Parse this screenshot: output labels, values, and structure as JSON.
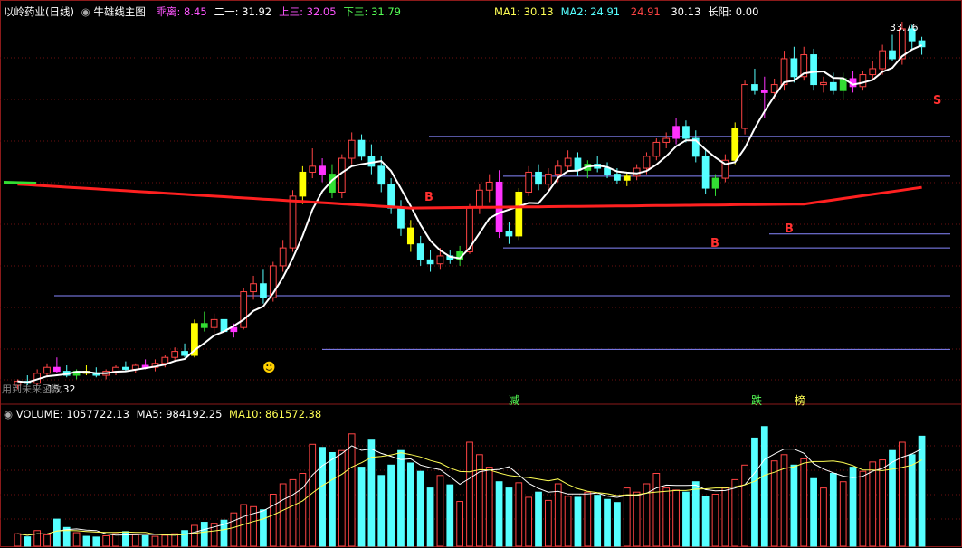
{
  "header": {
    "title": "以岭药业(日线)",
    "indicator_name": "牛雄线主图",
    "items": [
      {
        "label": "乖离:",
        "value": "8.45",
        "color": "#ff55ff"
      },
      {
        "label": "二一:",
        "value": "31.92",
        "color": "#ffffff"
      },
      {
        "label": "上三:",
        "value": "32.05",
        "color": "#ff55ff"
      },
      {
        "label": "下三:",
        "value": "31.79",
        "color": "#55ff55"
      }
    ],
    "ma": [
      {
        "label": "MA1:",
        "value": "30.13",
        "color": "#ffff55"
      },
      {
        "label": "MA2:",
        "value": "24.91",
        "color": "#55ffff"
      },
      {
        "label": "",
        "value": "24.91",
        "color": "#ff4444"
      },
      {
        "label": "",
        "value": "30.13",
        "color": "#ffffff"
      },
      {
        "label": "长阳:",
        "value": "0.00",
        "color": "#ffffff"
      }
    ]
  },
  "volume_header": {
    "volume": "VOLUME: 1057722.13",
    "ma5": "MA5: 984192.25",
    "ma10": "MA10: 861572.38",
    "colors": {
      "volume": "#ffffff",
      "ma5": "#ffffff",
      "ma10": "#ffff55"
    }
  },
  "labels": {
    "high_price": "33.76",
    "low_price": "15.32",
    "bottom_hint": "用到未来函数",
    "reduce": "减",
    "drop": "跌",
    "rank": "榜",
    "buy_marks": [
      "B",
      "B",
      "B",
      "B"
    ],
    "sell_mark": "S"
  },
  "colors": {
    "up": "#ff4444",
    "down": "#55ffff",
    "magenta": "#ff33ff",
    "yellow": "#ffff00",
    "green": "#33dd33",
    "white_line": "#ffffff",
    "red_line": "#ff2020",
    "guide": "#8888ff",
    "border": "#8b1a1a"
  },
  "chart_data": [
    {
      "type": "candlestick",
      "title": "以岭药业(日线)",
      "y_range": [
        15.32,
        33.76
      ],
      "ohlc": [
        [
          15.5,
          15.8,
          15.3,
          15.7
        ],
        [
          15.7,
          16.0,
          15.5,
          15.6
        ],
        [
          15.6,
          16.3,
          15.5,
          16.1
        ],
        [
          16.1,
          16.6,
          15.9,
          16.4
        ],
        [
          16.4,
          16.9,
          16.1,
          16.2
        ],
        [
          16.2,
          16.5,
          15.9,
          16.0
        ],
        [
          16.0,
          16.3,
          15.8,
          16.2
        ],
        [
          16.2,
          16.5,
          16.0,
          16.1
        ],
        [
          16.1,
          16.4,
          15.9,
          16.0
        ],
        [
          16.0,
          16.3,
          15.8,
          16.2
        ],
        [
          16.2,
          16.5,
          16.0,
          16.4
        ],
        [
          16.4,
          16.7,
          16.2,
          16.3
        ],
        [
          16.3,
          16.6,
          16.1,
          16.5
        ],
        [
          16.5,
          16.8,
          16.3,
          16.4
        ],
        [
          16.4,
          16.8,
          16.2,
          16.6
        ],
        [
          16.6,
          17.0,
          16.4,
          16.9
        ],
        [
          16.9,
          17.4,
          16.7,
          17.2
        ],
        [
          17.2,
          17.6,
          16.9,
          17.0
        ],
        [
          17.0,
          18.8,
          16.9,
          18.6
        ],
        [
          18.6,
          19.2,
          18.2,
          18.4
        ],
        [
          18.4,
          19.1,
          18.1,
          18.8
        ],
        [
          18.8,
          19.0,
          18.0,
          18.2
        ],
        [
          18.2,
          18.6,
          17.9,
          18.4
        ],
        [
          18.4,
          20.4,
          18.3,
          20.2
        ],
        [
          20.2,
          21.0,
          19.8,
          20.6
        ],
        [
          20.6,
          21.3,
          19.6,
          19.9
        ],
        [
          19.9,
          21.7,
          19.7,
          21.5
        ],
        [
          21.5,
          22.8,
          21.2,
          22.4
        ],
        [
          22.4,
          25.3,
          22.2,
          25.0
        ],
        [
          25.0,
          26.5,
          24.6,
          26.2
        ],
        [
          26.2,
          27.4,
          25.9,
          26.5
        ],
        [
          26.5,
          26.9,
          25.7,
          26.1
        ],
        [
          26.1,
          26.6,
          24.9,
          25.2
        ],
        [
          25.2,
          27.1,
          24.9,
          26.9
        ],
        [
          26.9,
          28.2,
          26.6,
          27.8
        ],
        [
          27.8,
          28.1,
          26.8,
          27.0
        ],
        [
          27.0,
          27.6,
          26.1,
          26.5
        ],
        [
          26.5,
          27.0,
          25.2,
          25.6
        ],
        [
          25.6,
          25.9,
          24.1,
          24.4
        ],
        [
          24.4,
          24.8,
          23.0,
          23.4
        ],
        [
          23.4,
          23.8,
          22.2,
          22.6
        ],
        [
          22.6,
          23.0,
          21.5,
          21.8
        ],
        [
          21.8,
          22.3,
          21.2,
          21.6
        ],
        [
          21.6,
          22.4,
          21.3,
          22.0
        ],
        [
          22.0,
          22.3,
          21.6,
          21.8
        ],
        [
          21.8,
          22.5,
          21.5,
          22.2
        ],
        [
          22.2,
          24.6,
          22.1,
          24.4
        ],
        [
          24.4,
          25.6,
          24.1,
          25.3
        ],
        [
          25.3,
          26.1,
          24.7,
          25.7
        ],
        [
          25.7,
          26.3,
          22.9,
          23.2
        ],
        [
          23.2,
          23.7,
          22.6,
          23.0
        ],
        [
          23.0,
          25.4,
          22.8,
          25.2
        ],
        [
          25.2,
          26.5,
          25.0,
          26.2
        ],
        [
          26.2,
          26.6,
          25.3,
          25.6
        ],
        [
          25.6,
          26.4,
          25.3,
          26.1
        ],
        [
          26.1,
          26.8,
          25.7,
          26.5
        ],
        [
          26.5,
          27.3,
          26.2,
          26.9
        ],
        [
          26.9,
          27.2,
          26.0,
          26.3
        ],
        [
          26.3,
          26.8,
          25.9,
          26.6
        ],
        [
          26.6,
          27.0,
          26.2,
          26.4
        ],
        [
          26.4,
          26.7,
          25.9,
          26.1
        ],
        [
          26.1,
          26.4,
          25.6,
          25.8
        ],
        [
          25.8,
          26.2,
          25.5,
          26.0
        ],
        [
          26.0,
          26.6,
          25.8,
          26.4
        ],
        [
          26.4,
          27.2,
          26.1,
          27.0
        ],
        [
          27.0,
          27.9,
          26.8,
          27.7
        ],
        [
          27.7,
          28.2,
          27.4,
          27.9
        ],
        [
          27.9,
          28.9,
          27.6,
          28.5
        ],
        [
          28.5,
          28.8,
          27.7,
          27.9
        ],
        [
          27.9,
          28.3,
          26.7,
          27.0
        ],
        [
          27.0,
          27.4,
          25.1,
          25.4
        ],
        [
          25.4,
          26.1,
          25.0,
          25.9
        ],
        [
          25.9,
          27.1,
          25.7,
          26.8
        ],
        [
          26.8,
          28.7,
          26.6,
          28.4
        ],
        [
          28.4,
          30.8,
          28.1,
          30.6
        ],
        [
          30.6,
          31.4,
          30.1,
          30.3
        ],
        [
          30.3,
          31.0,
          28.9,
          30.2
        ],
        [
          30.2,
          30.9,
          29.9,
          30.6
        ],
        [
          30.6,
          32.3,
          30.3,
          31.9
        ],
        [
          31.9,
          32.5,
          30.7,
          31.0
        ],
        [
          31.0,
          32.5,
          30.8,
          32.1
        ],
        [
          32.1,
          32.4,
          30.3,
          30.6
        ],
        [
          30.6,
          31.0,
          30.2,
          30.7
        ],
        [
          30.7,
          31.2,
          30.1,
          30.3
        ],
        [
          30.3,
          31.2,
          29.9,
          30.9
        ],
        [
          30.9,
          31.3,
          30.2,
          30.5
        ],
        [
          30.5,
          31.3,
          30.3,
          31.1
        ],
        [
          31.1,
          31.8,
          30.8,
          31.4
        ],
        [
          31.4,
          32.6,
          31.1,
          32.3
        ],
        [
          32.3,
          33.1,
          31.8,
          31.9
        ],
        [
          31.9,
          33.76,
          31.6,
          33.4
        ],
        [
          33.4,
          33.6,
          32.4,
          32.8
        ],
        [
          32.8,
          33.0,
          32.1,
          32.5
        ]
      ],
      "ma_white_label": "MA1",
      "ma_red_label": "MA2",
      "guide_levels": [
        28.0,
        26.0,
        23.1,
        22.4,
        20.0,
        17.3
      ]
    },
    {
      "type": "bar",
      "title": "VOLUME",
      "values": [
        120000,
        90000,
        150000,
        110000,
        260000,
        180000,
        130000,
        95000,
        88000,
        100000,
        120000,
        140000,
        110000,
        100000,
        95000,
        105000,
        120000,
        150000,
        200000,
        230000,
        220000,
        250000,
        320000,
        400000,
        380000,
        350000,
        500000,
        600000,
        640000,
        700000,
        980000,
        950000,
        900000,
        920000,
        1080000,
        760000,
        1020000,
        680000,
        780000,
        920000,
        800000,
        720000,
        560000,
        680000,
        590000,
        430000,
        1000000,
        880000,
        760000,
        620000,
        560000,
        610000,
        470000,
        520000,
        440000,
        600000,
        480000,
        470000,
        520000,
        490000,
        450000,
        420000,
        560000,
        520000,
        600000,
        700000,
        560000,
        540000,
        520000,
        620000,
        480000,
        500000,
        560000,
        640000,
        780000,
        1040000,
        1150000,
        820000,
        880000,
        780000,
        840000,
        650000,
        560000,
        700000,
        620000,
        760000,
        720000,
        810000,
        830000,
        920000,
        1000000,
        880000,
        1057722
      ],
      "ma5_label": "MA5",
      "ma10_label": "MA10"
    }
  ]
}
